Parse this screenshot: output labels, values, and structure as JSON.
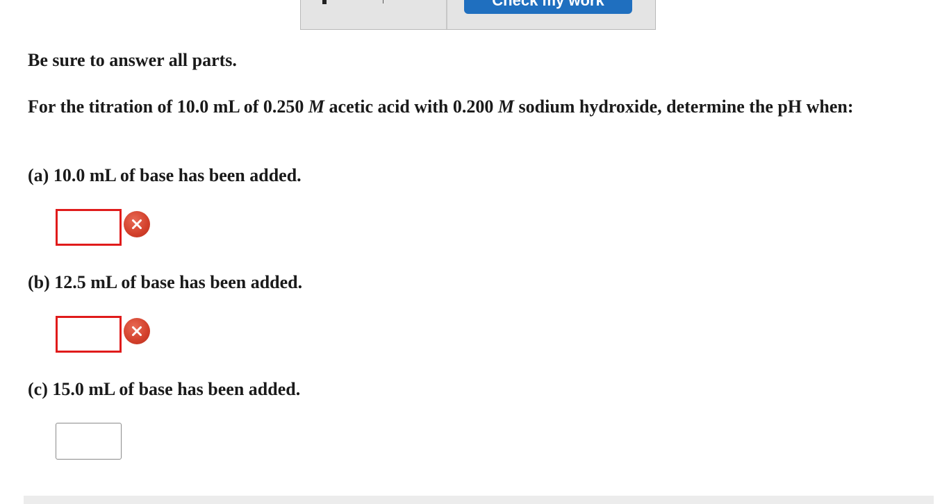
{
  "toolbar": {
    "check_label": "Check my work"
  },
  "question": {
    "instructions": "Be sure to answer all parts.",
    "problem_part1": "For the titration of 10.0 mL of 0.250 ",
    "molarity_symbol_1": "M",
    "problem_part2": " acetic acid with 0.200 ",
    "molarity_symbol_2": "M",
    "problem_part3": " sodium hydroxide, determine the pH when:"
  },
  "parts": [
    {
      "label": "(a) 10.0 mL of base has been added.",
      "value": "",
      "status": "incorrect"
    },
    {
      "label": "(b) 12.5 mL of base has been added.",
      "value": "",
      "status": "incorrect"
    },
    {
      "label": "(c) 15.0 mL of base has been added.",
      "value": "",
      "status": "unanswered"
    }
  ],
  "colors": {
    "check_button": "#1f6fbf",
    "incorrect_border": "#e01b1b",
    "incorrect_icon": "#d23f2a"
  }
}
